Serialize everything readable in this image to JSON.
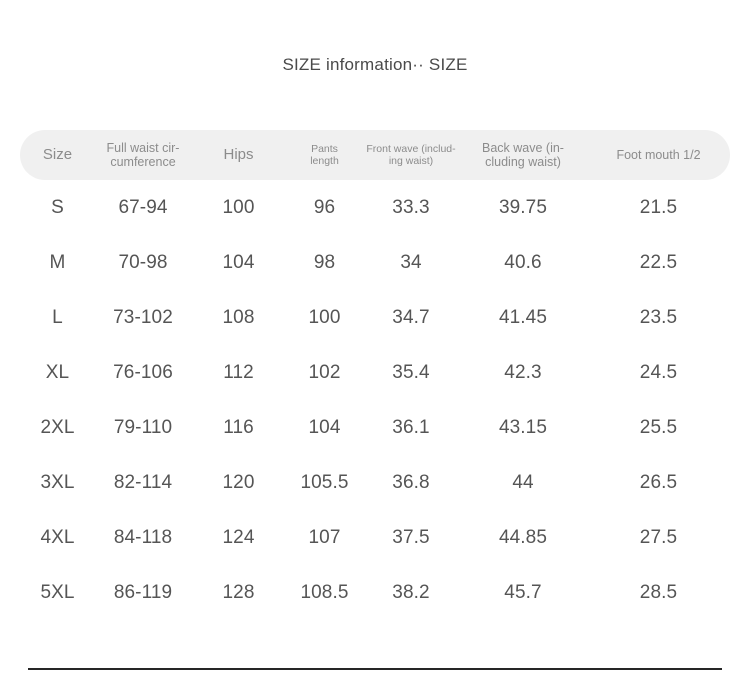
{
  "title": "SIZE information·· SIZE",
  "table": {
    "headers": [
      "Size",
      "Full waist cir-cumference",
      "Hips",
      "Pants length",
      "Front wave (includ-ing waist)",
      "Back wave (in-cluding waist)",
      "Foot mouth 1/2"
    ],
    "headers_display": {
      "size": "Size",
      "waist_line1": "Full waist cir-",
      "waist_line2": "cumference",
      "hips": "Hips",
      "pants_line1": "Pants",
      "pants_line2": "length",
      "front_line1": "Front wave (includ-",
      "front_line2": "ing waist)",
      "back_line1": "Back wave (in-",
      "back_line2": "cluding waist)",
      "foot": "Foot mouth 1/2"
    },
    "rows": [
      {
        "size": "S",
        "waist": "67-94",
        "hips": "100",
        "pants_length": "96",
        "front_wave": "33.3",
        "back_wave": "39.75",
        "foot_mouth": "21.5"
      },
      {
        "size": "M",
        "waist": "70-98",
        "hips": "104",
        "pants_length": "98",
        "front_wave": "34",
        "back_wave": "40.6",
        "foot_mouth": "22.5"
      },
      {
        "size": "L",
        "waist": "73-102",
        "hips": "108",
        "pants_length": "100",
        "front_wave": "34.7",
        "back_wave": "41.45",
        "foot_mouth": "23.5"
      },
      {
        "size": "XL",
        "waist": "76-106",
        "hips": "112",
        "pants_length": "102",
        "front_wave": "35.4",
        "back_wave": "42.3",
        "foot_mouth": "24.5"
      },
      {
        "size": "2XL",
        "waist": "79-110",
        "hips": "116",
        "pants_length": "104",
        "front_wave": "36.1",
        "back_wave": "43.15",
        "foot_mouth": "25.5"
      },
      {
        "size": "3XL",
        "waist": "82-114",
        "hips": "120",
        "pants_length": "105.5",
        "front_wave": "36.8",
        "back_wave": "44",
        "foot_mouth": "26.5"
      },
      {
        "size": "4XL",
        "waist": "84-118",
        "hips": "124",
        "pants_length": "107",
        "front_wave": "37.5",
        "back_wave": "44.85",
        "foot_mouth": "27.5"
      },
      {
        "size": "5XL",
        "waist": "86-119",
        "hips": "128",
        "pants_length": "108.5",
        "front_wave": "38.2",
        "back_wave": "45.7",
        "foot_mouth": "28.5"
      }
    ]
  },
  "colors": {
    "header_background": "#f0f0f0",
    "header_text": "#8c8c8c",
    "data_text": "#555555",
    "title_text": "#4a4a4a",
    "rule": "#262626",
    "page_background": "#ffffff"
  }
}
